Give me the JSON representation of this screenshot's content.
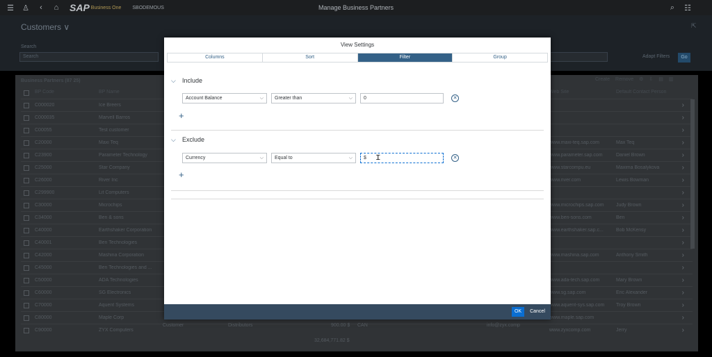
{
  "shell": {
    "company": "SBODEMOUS",
    "title": "Manage Business Partners",
    "logo_text": "SAP",
    "logo_sub": "Business One"
  },
  "page": {
    "title": "Customers ∨",
    "search_label": "Search",
    "search_placeholder": "Search",
    "adapt_filters": "Adapt Filters",
    "go": "Go"
  },
  "table": {
    "title": "Business Partners (87 25)",
    "tools": [
      "Create",
      "Remove"
    ],
    "headers": {
      "code": "BP Code",
      "name": "BP Name",
      "web": "Web Site",
      "contact": "Default Contact Person"
    },
    "rows": [
      {
        "code": "C000020",
        "name": "Ice Breers",
        "web": "",
        "contact": ""
      },
      {
        "code": "C000035",
        "name": "Marvell Barros",
        "web": "",
        "contact": ""
      },
      {
        "code": "C00055",
        "name": "Test customer",
        "web": "",
        "contact": ""
      },
      {
        "code": "C20000",
        "name": "Maxi Teq",
        "web": "www.maxi-teq.sap.com",
        "contact": "Max Teq"
      },
      {
        "code": "C23900",
        "name": "Parameter Technology",
        "web": "www.parameter.sap.com",
        "contact": "Daniel Brown"
      },
      {
        "code": "C25000",
        "name": "Star Company",
        "web": "www.starcompu.eu",
        "contact": "Maxima Bosalykova"
      },
      {
        "code": "C26000",
        "name": "River Inc",
        "web": "www.river.com",
        "contact": "Lewis Bowman"
      },
      {
        "code": "C299900",
        "name": "Lit Computers",
        "web": "",
        "contact": ""
      },
      {
        "code": "C30000",
        "name": "Microchips",
        "web": "www.microchips.sap.com",
        "contact": "Judy Brown"
      },
      {
        "code": "C34000",
        "name": "Ben & sons",
        "web": "www.ben-sons.com",
        "contact": "Ben"
      },
      {
        "code": "C40000",
        "name": "Earthshaker Corporation",
        "web": "www.earthshaker.sap.c...",
        "contact": "Bob McKensy"
      },
      {
        "code": "C40001",
        "name": "Ben Technologies",
        "web": "",
        "contact": ""
      },
      {
        "code": "C42000",
        "name": "Mashina Corporation",
        "web": "www.mashina.sap.com",
        "contact": "Anthony Smith"
      },
      {
        "code": "C45000",
        "name": "Ben Technologies and ...",
        "web": "",
        "contact": ""
      },
      {
        "code": "C50000",
        "name": "ADA Technologies",
        "web": "www.ada-tech.sap.com",
        "contact": "Mary Brown"
      },
      {
        "code": "C60000",
        "name": "SG Electronics",
        "web": "www.sg.sap.com",
        "contact": "Eric Alexander"
      },
      {
        "code": "C70000",
        "name": "Aquent Systems",
        "web": "www.aquent-sys.sap.com",
        "contact": "Troy Brown"
      },
      {
        "code": "C80000",
        "name": "Maple Corp",
        "web": "www.maple.sap.com",
        "contact": ""
      },
      {
        "code": "C90000",
        "name": "ZYX Computers",
        "web": "www.zyxcomp.com",
        "contact": "Jerry"
      }
    ],
    "last_row_extra": {
      "type": "Customer",
      "group": "Distributors",
      "balance": "900.00 $",
      "currency": "CAN",
      "email": "info@zyx.comp"
    },
    "total": "32,684,771.82 $"
  },
  "dialog": {
    "title": "View Settings",
    "tabs": [
      "Columns",
      "Sort",
      "Filter",
      "Group"
    ],
    "active_tab": "Filter",
    "include": {
      "label": "Include",
      "field": "Account Balance",
      "operator": "Greater than",
      "value": "0"
    },
    "exclude": {
      "label": "Exclude",
      "field": "Currency",
      "operator": "Equal to",
      "value": "$"
    },
    "ok": "OK",
    "cancel": "Cancel"
  },
  "colors": {
    "accent": "#346187",
    "ok": "#0a6ed1",
    "footer": "#354a5f"
  }
}
